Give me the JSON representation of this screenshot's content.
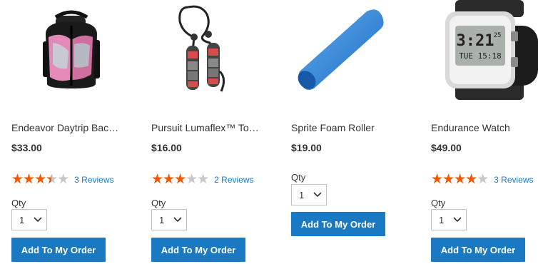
{
  "products": [
    {
      "name": "Endeavor Daytrip Bac…",
      "price": "$33.00",
      "rating_fraction": 0.7,
      "reviews": "3 Reviews",
      "qty_label": "Qty",
      "qty_value": "1",
      "button": "Add To My Order",
      "icon": "backpack"
    },
    {
      "name": "Pursuit Lumaflex™ To…",
      "price": "$16.00",
      "rating_fraction": 0.6,
      "reviews": "2 Reviews",
      "qty_label": "Qty",
      "qty_value": "1",
      "button": "Add To My Order",
      "icon": "resistance-bands"
    },
    {
      "name": "Sprite Foam Roller",
      "price": "$19.00",
      "qty_label": "Qty",
      "qty_value": "1",
      "button": "Add To My Order",
      "icon": "foam-roller"
    },
    {
      "name": "Endurance Watch",
      "price": "$49.00",
      "rating_fraction": 0.8,
      "reviews": "3 Reviews",
      "qty_label": "Qty",
      "qty_value": "1",
      "button": "Add To My Order",
      "icon": "watch"
    }
  ],
  "watch_display": {
    "time": "3:21",
    "sub": "TUE 15:18",
    "sec": "25"
  },
  "colors": {
    "accent": "#1979c3",
    "star": "#ff5501",
    "star_empty": "#c7c7c7"
  }
}
